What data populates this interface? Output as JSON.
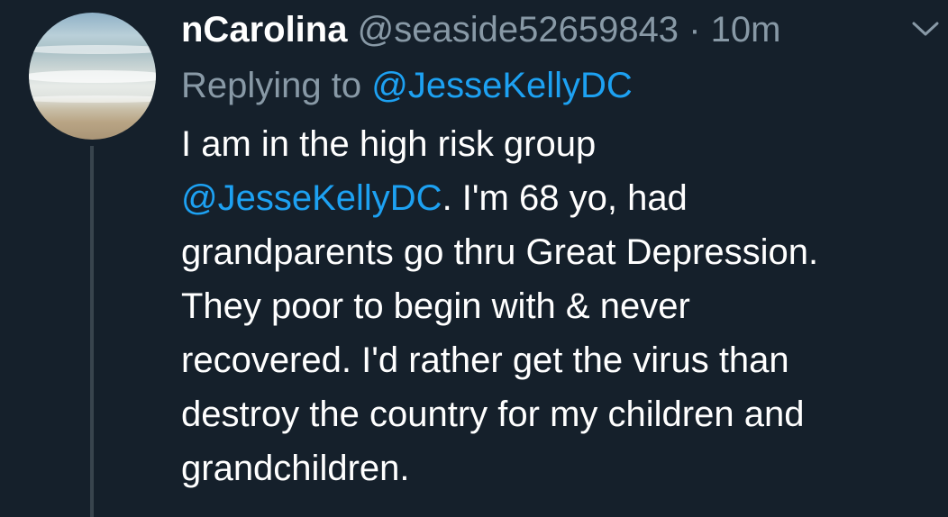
{
  "tweet": {
    "display_name": "nCarolina",
    "handle": "@seaside52659843",
    "separator": "·",
    "time": "10m",
    "replying_prefix": "Replying to",
    "replying_to": "@JesseKellyDC",
    "body_lines": [
      {
        "text": "I am in the high risk group"
      },
      {
        "mention": "@JesseKellyDC",
        "text": ". I'm 68 yo, had"
      },
      {
        "text": "grandparents go thru Great Depression."
      },
      {
        "text": "They poor to begin with & never"
      },
      {
        "text": "recovered. I'd rather get the virus than"
      },
      {
        "text": "destroy the country for my children and"
      },
      {
        "text": "grandchildren."
      }
    ]
  },
  "icons": {
    "avatar": "beach-avatar",
    "menu": "chevron-down-icon"
  },
  "colors": {
    "background": "#15202b",
    "primary_text": "#ffffff",
    "secondary_text": "#8899a6",
    "link": "#1da1f2",
    "thread_line": "#38444d"
  }
}
